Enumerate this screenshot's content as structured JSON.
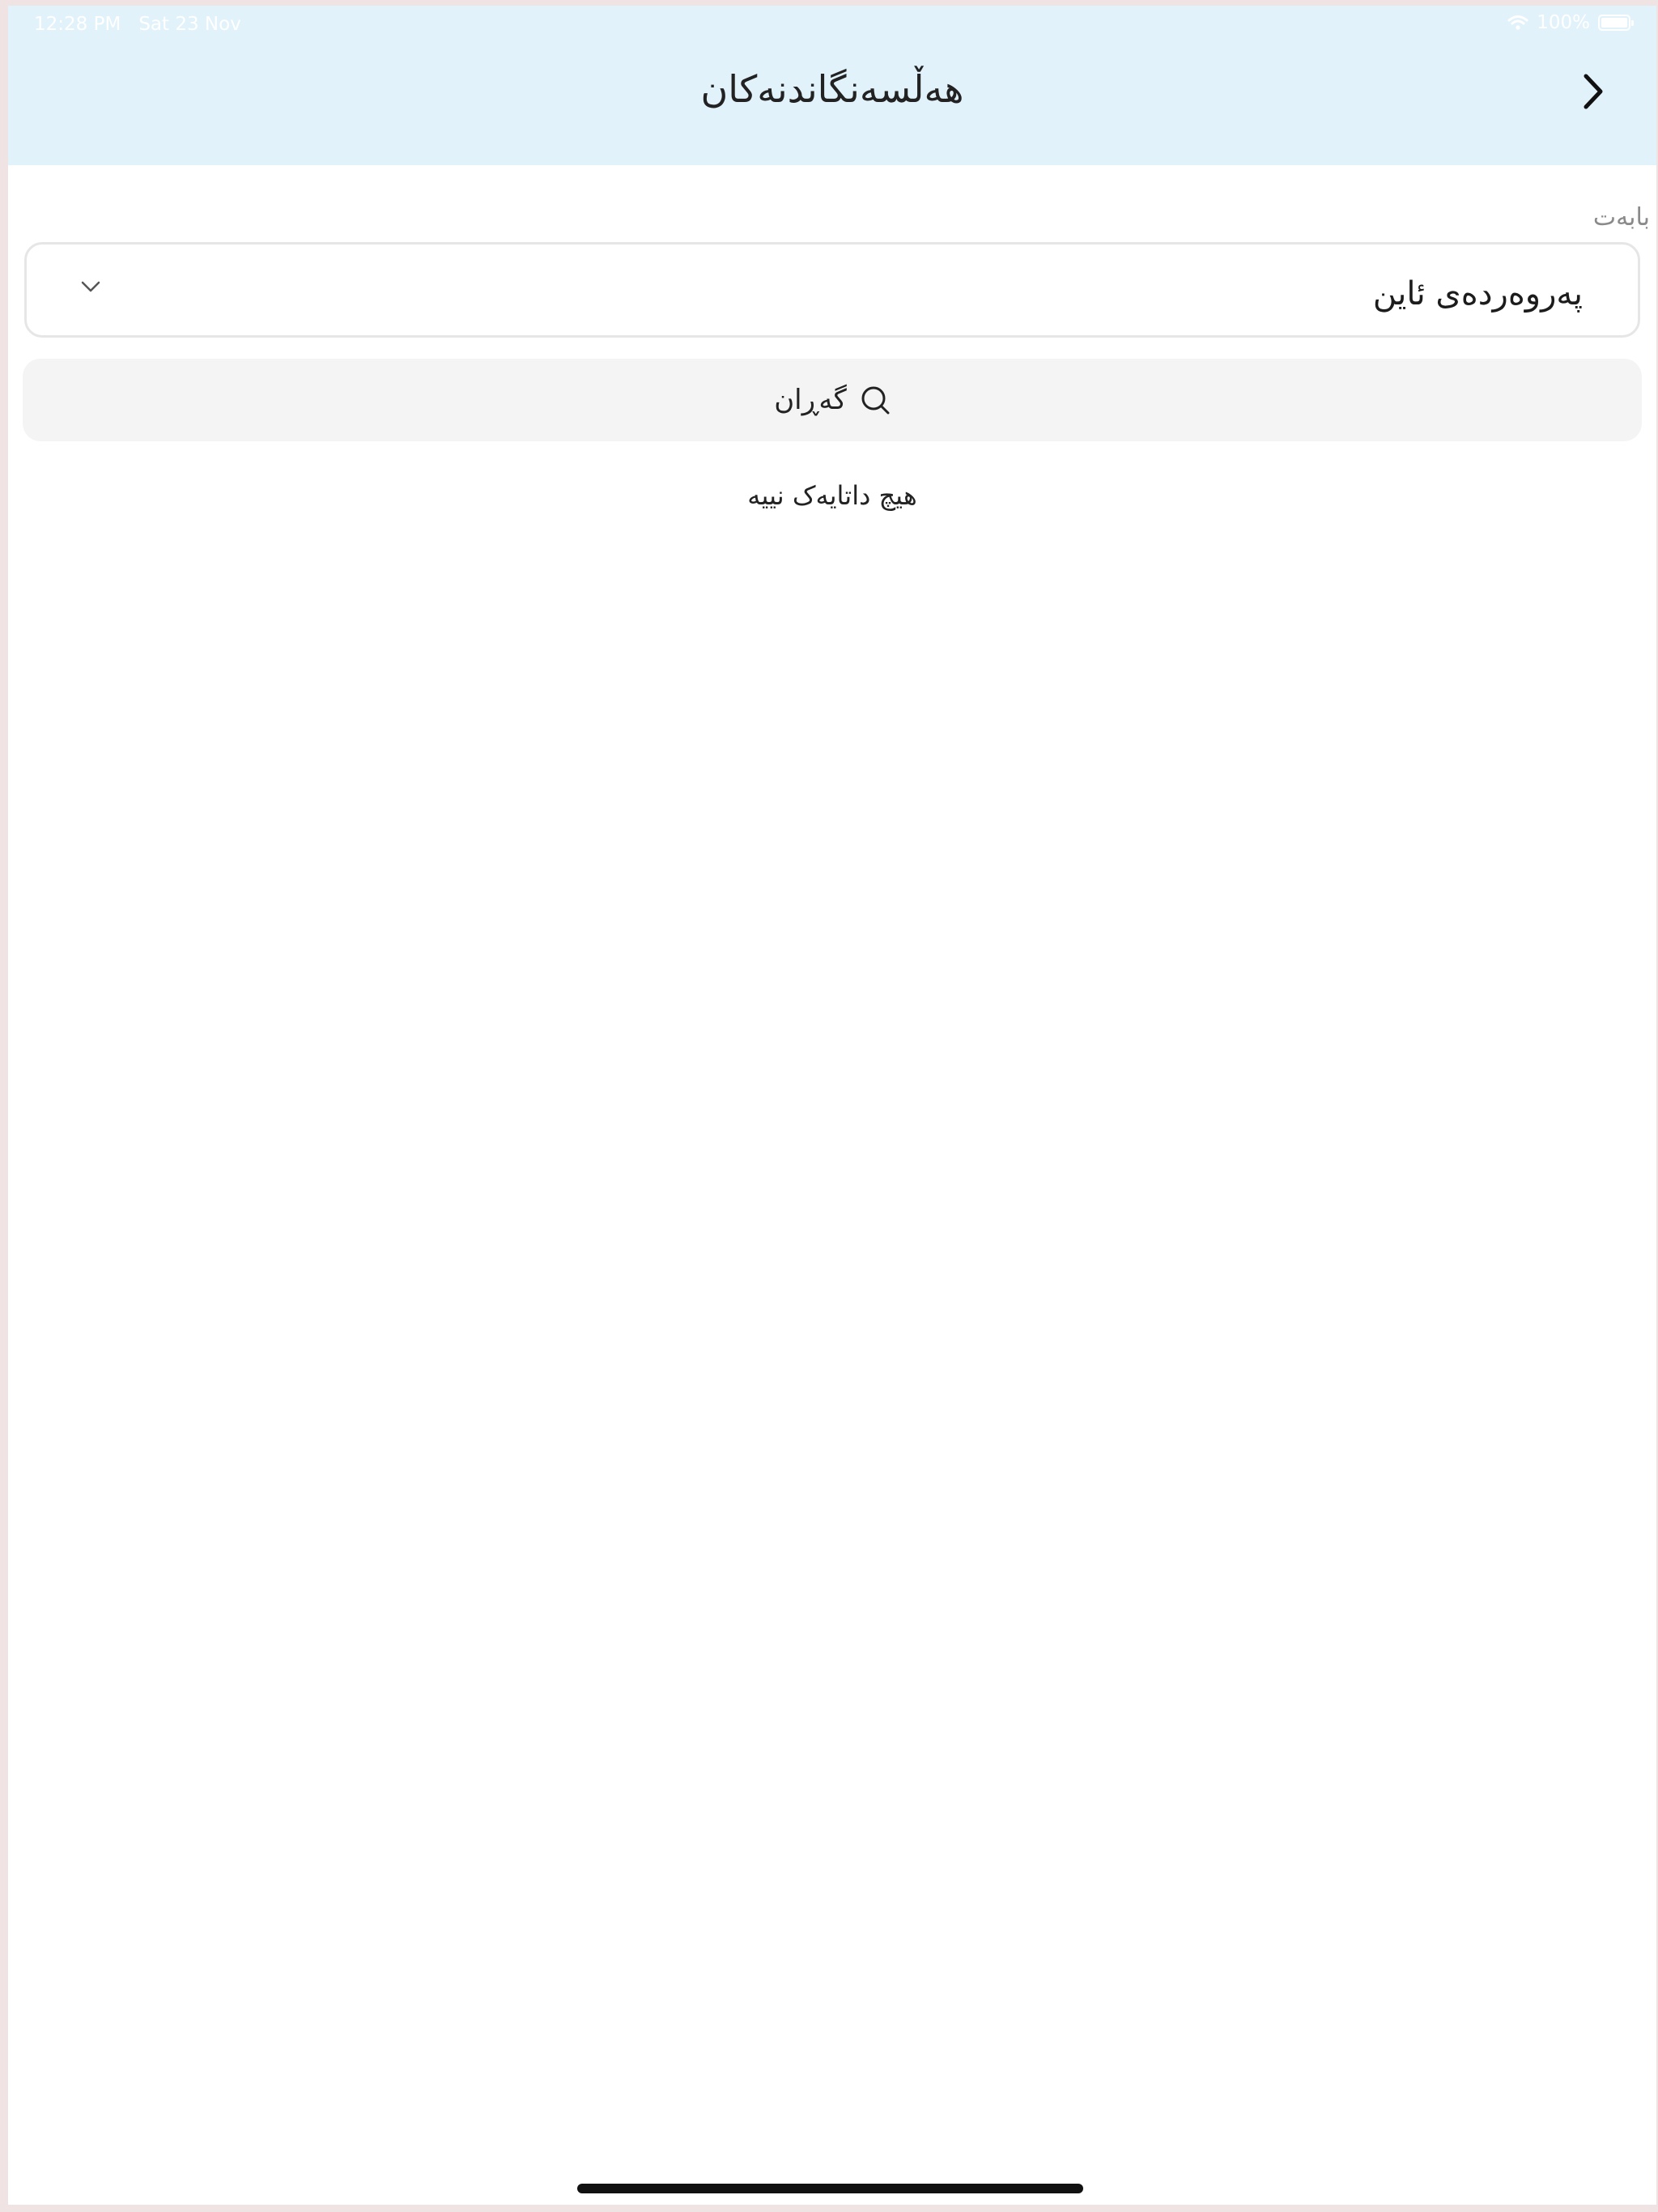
{
  "status_bar": {
    "time": "12:28 PM",
    "date": "Sat 23 Nov",
    "battery": "100%",
    "wifi_icon": "wifi-icon",
    "battery_icon": "battery-icon"
  },
  "header": {
    "title": "هەڵسەنگاندنەکان",
    "back_icon": "chevron-right-icon",
    "background": "#e1f2fb"
  },
  "form": {
    "subject_label": "بابەت",
    "subject_value": "پەروەردەی ئاین",
    "dropdown_icon": "chevron-down-icon"
  },
  "search": {
    "label": "گەڕان",
    "icon": "search-icon"
  },
  "results": {
    "empty_message": "هیچ داتایەک نییە"
  }
}
